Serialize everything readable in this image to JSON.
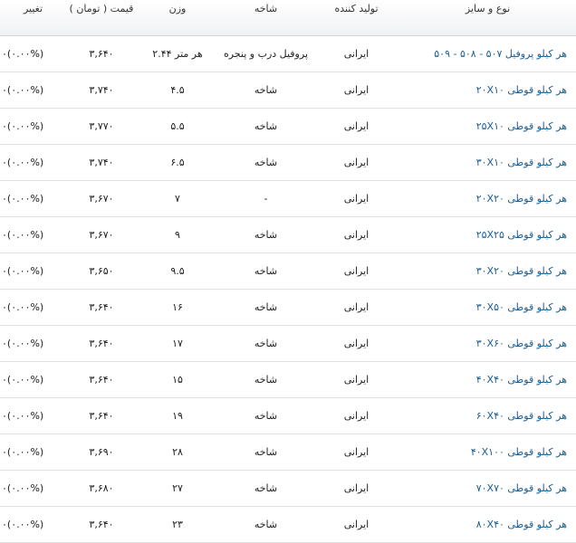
{
  "table": {
    "headers": {
      "type": "نوع و سایز",
      "producer": "تولید کننده",
      "branch": "شاخه",
      "weight": "وزن",
      "price": "قیمت ( تومان )",
      "change": "تغییر"
    },
    "rows": [
      {
        "type": "هر کیلو پروفیل ۵۰۷ - ۵۰۸ - ۵۰۹",
        "producer": "ایرانی",
        "branch": "پروفیل درب و پنجره",
        "weight": "هر متر ۲.۴۴",
        "price": "۳,۶۴۰",
        "change": "(۰.۰۰%)۰"
      },
      {
        "type": "هر کیلو قوطی ۲۰X۱۰",
        "producer": "ایرانی",
        "branch": "شاخه",
        "weight": "۴.۵",
        "price": "۳,۷۴۰",
        "change": "(۰.۰۰%)۰"
      },
      {
        "type": "هر کیلو قوطی ۲۵X۱۰",
        "producer": "ایرانی",
        "branch": "شاخه",
        "weight": "۵.۵",
        "price": "۳,۷۷۰",
        "change": "(۰.۰۰%)۰"
      },
      {
        "type": "هر کیلو قوطی ۳۰X۱۰",
        "producer": "ایرانی",
        "branch": "شاخه",
        "weight": "۶.۵",
        "price": "۳,۷۴۰",
        "change": "(۰.۰۰%)۰"
      },
      {
        "type": "هر کیلو قوطی ۲۰X۲۰",
        "producer": "ایرانی",
        "branch": "-",
        "weight": "۷",
        "price": "۳,۶۷۰",
        "change": "(۰.۰۰%)۰"
      },
      {
        "type": "هر کیلو قوطی ۲۵X۲۵",
        "producer": "ایرانی",
        "branch": "شاخه",
        "weight": "۹",
        "price": "۳,۶۷۰",
        "change": "(۰.۰۰%)۰"
      },
      {
        "type": "هر کیلو قوطی ۳۰X۲۰",
        "producer": "ایرانی",
        "branch": "شاخه",
        "weight": "۹.۵",
        "price": "۳,۶۵۰",
        "change": "(۰.۰۰%)۰"
      },
      {
        "type": "هر کیلو قوطی ۳۰X۵۰",
        "producer": "ایرانی",
        "branch": "شاخه",
        "weight": "۱۶",
        "price": "۳,۶۴۰",
        "change": "(۰.۰۰%)۰"
      },
      {
        "type": "هر کیلو قوطی ۳۰X۶۰",
        "producer": "ایرانی",
        "branch": "شاخه",
        "weight": "۱۷",
        "price": "۳,۶۴۰",
        "change": "(۰.۰۰%)۰"
      },
      {
        "type": "هر کیلو قوطی ۴۰X۴۰",
        "producer": "ایرانی",
        "branch": "شاخه",
        "weight": "۱۵",
        "price": "۳,۶۴۰",
        "change": "(۰.۰۰%)۰"
      },
      {
        "type": "هر کیلو قوطی ۶۰X۴۰",
        "producer": "ایرانی",
        "branch": "شاخه",
        "weight": "۱۹",
        "price": "۳,۶۴۰",
        "change": "(۰.۰۰%)۰"
      },
      {
        "type": "هر کیلو قوطی ۴۰X۱۰۰",
        "producer": "ایرانی",
        "branch": "شاخه",
        "weight": "۲۸",
        "price": "۳,۶۹۰",
        "change": "(۰.۰۰%)۰"
      },
      {
        "type": "هر کیلو قوطی ۷۰X۷۰",
        "producer": "ایرانی",
        "branch": "شاخه",
        "weight": "۲۷",
        "price": "۳,۶۸۰",
        "change": "(۰.۰۰%)۰"
      },
      {
        "type": "هر کیلو قوطی ۸۰X۴۰",
        "producer": "ایرانی",
        "branch": "شاخه",
        "weight": "۲۳",
        "price": "۳,۶۴۰",
        "change": "(۰.۰۰%)۰"
      }
    ]
  },
  "colors": {
    "link": "#1b5d92",
    "text": "#222222",
    "divider": "#dcdfe3"
  }
}
